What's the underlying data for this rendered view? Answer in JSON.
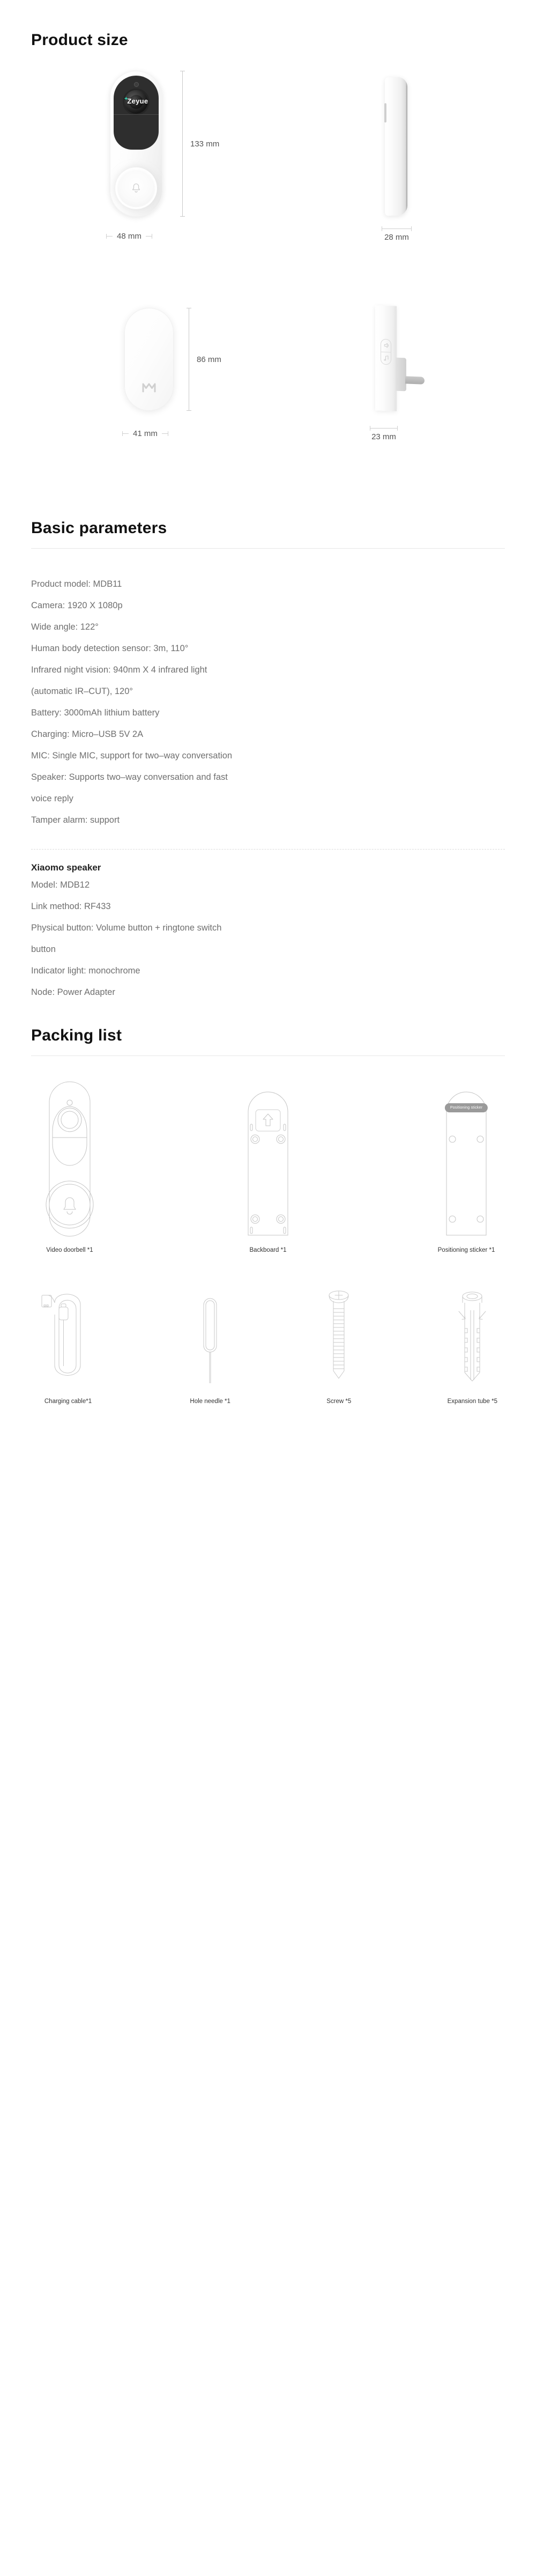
{
  "sections": {
    "product_size": {
      "title": "Product size",
      "figures": [
        {
          "name": "video-doorbell-front",
          "brand": "Zeyue",
          "height_label": "133 mm",
          "width_label": "48 mm"
        },
        {
          "name": "video-doorbell-side",
          "width_label": "28 mm"
        },
        {
          "name": "chime-front",
          "height_label": "86 mm",
          "width_label": "41 mm"
        },
        {
          "name": "chime-side",
          "width_label": "23 mm"
        }
      ]
    },
    "basic_parameters": {
      "title": "Basic parameters",
      "lines": [
        "Product model: MDB11",
        "Camera: 1920 X 1080p",
        "Wide angle: 122°",
        "Human body detection sensor: 3m, 110°",
        "Infrared night vision: 940nm X 4 infrared light",
        "(automatic IR–CUT), 120°",
        "Battery: 3000mAh lithium battery",
        "Charging: Micro–USB 5V 2A",
        "MIC: Single MIC, support for two–way conversation",
        "Speaker: Supports two–way conversation and fast",
        "voice reply",
        "Tamper alarm: support"
      ]
    },
    "speaker": {
      "title": "Xiaomo speaker",
      "lines": [
        "Model: MDB12",
        "Link method: RF433",
        "Physical button: Volume button + ringtone switch",
        "button",
        "Indicator light: monochrome",
        "Node: Power Adapter"
      ]
    },
    "packing_list": {
      "title": "Packing list",
      "sticker_label": "Positioning sticker",
      "row1": [
        {
          "name": "video-doorbell",
          "caption": "Video doorbell *1"
        },
        {
          "name": "backboard",
          "caption": "Backboard *1"
        },
        {
          "name": "positioning-sticker",
          "caption": "Positioning sticker *1"
        }
      ],
      "row2": [
        {
          "name": "charging-cable",
          "caption": "Charging cable*1"
        },
        {
          "name": "hole-needle",
          "caption": "Hole needle *1"
        },
        {
          "name": "screw",
          "caption": "Screw *5"
        },
        {
          "name": "expansion-tube",
          "caption": "Expansion tube *5"
        }
      ]
    }
  },
  "colors": {
    "heading": "#111111",
    "body_text": "#6f6f6f",
    "rule": "#e6e6e6",
    "dimension_line": "#c9c9c9",
    "sticker_badge": "#9a9a9a",
    "brand_accent": "#36d6b4",
    "line_art": "#bdbdbd"
  }
}
